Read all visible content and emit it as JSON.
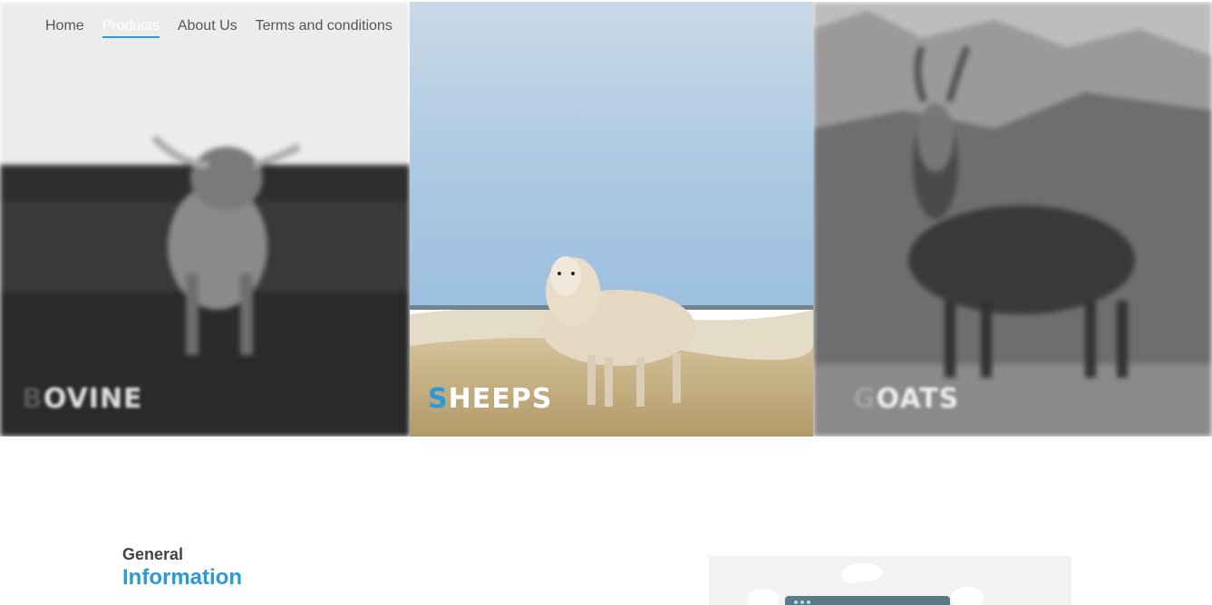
{
  "nav": {
    "items": [
      {
        "label": "Home",
        "active": false
      },
      {
        "label": "Products",
        "active": true
      },
      {
        "label": "About Us",
        "active": false
      },
      {
        "label": "Terms and conditions",
        "active": false
      }
    ]
  },
  "panels": [
    {
      "first_letter": "B",
      "rest": "OVINE",
      "focused": false
    },
    {
      "first_letter": "S",
      "rest": "HEEPS",
      "focused": true
    },
    {
      "first_letter": "G",
      "rest": "OATS",
      "focused": false
    }
  ],
  "info": {
    "subtitle": "General",
    "title": "Information"
  },
  "colors": {
    "accent": "#2a9ad8",
    "nav_text": "#555555",
    "heading_dark": "#444444"
  }
}
